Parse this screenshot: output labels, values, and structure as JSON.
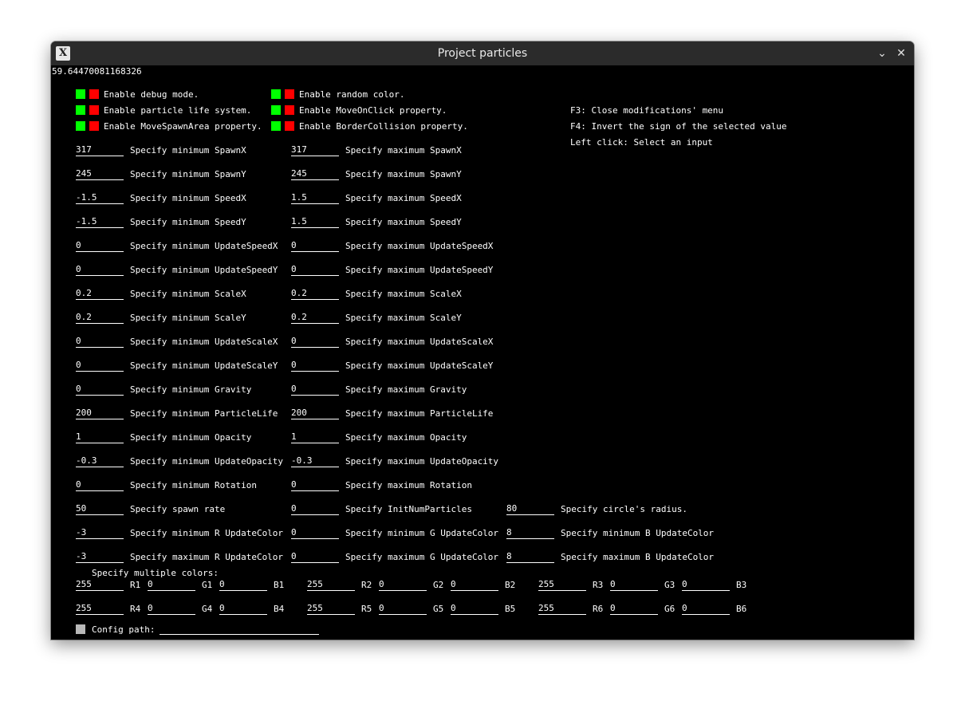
{
  "window": {
    "title": "Project particles",
    "icon": "x-window-icon",
    "controls": [
      "chevron-down-icon",
      "close-icon"
    ]
  },
  "fps": "59.64470081168326",
  "toggles": [
    {
      "label": "Enable debug mode."
    },
    {
      "label": "Enable particle life system."
    },
    {
      "label": "Enable MoveSpawnArea property."
    },
    {
      "label": "Enable random color."
    },
    {
      "label": "Enable MoveOnClick property."
    },
    {
      "label": "Enable BorderCollision property."
    }
  ],
  "help": [
    "F3: Close modifications' menu",
    "F4: Invert the sign of the selected value",
    "Left click: Select an input"
  ],
  "pairs": [
    {
      "min": "317",
      "min_label": "Specify minimum SpawnX",
      "max": "317",
      "max_label": "Specify maximum SpawnX"
    },
    {
      "min": "245",
      "min_label": "Specify minimum SpawnY",
      "max": "245",
      "max_label": "Specify maximum SpawnY"
    },
    {
      "min": "-1.5",
      "min_label": "Specify minimum SpeedX",
      "max": "1.5",
      "max_label": "Specify maximum SpeedX"
    },
    {
      "min": "-1.5",
      "min_label": "Specify minimum SpeedY",
      "max": "1.5",
      "max_label": "Specify maximum SpeedY"
    },
    {
      "min": "0",
      "min_label": "Specify minimum UpdateSpeedX",
      "max": "0",
      "max_label": "Specify maximum UpdateSpeedX"
    },
    {
      "min": "0",
      "min_label": "Specify minimum UpdateSpeedY",
      "max": "0",
      "max_label": "Specify maximum UpdateSpeedY"
    },
    {
      "min": "0.2",
      "min_label": "Specify minimum ScaleX",
      "max": "0.2",
      "max_label": "Specify maximum ScaleX"
    },
    {
      "min": "0.2",
      "min_label": "Specify minimum ScaleY",
      "max": "0.2",
      "max_label": "Specify maximum ScaleY"
    },
    {
      "min": "0",
      "min_label": "Specify minimum UpdateScaleX",
      "max": "0",
      "max_label": "Specify maximum UpdateScaleX"
    },
    {
      "min": "0",
      "min_label": "Specify minimum UpdateScaleY",
      "max": "0",
      "max_label": "Specify maximum UpdateScaleY"
    },
    {
      "min": "0",
      "min_label": "Specify minimum Gravity",
      "max": "0",
      "max_label": "Specify maximum Gravity"
    },
    {
      "min": "200",
      "min_label": "Specify minimum ParticleLife",
      "max": "200",
      "max_label": "Specify maximum ParticleLife"
    },
    {
      "min": "1",
      "min_label": "Specify minimum Opacity",
      "max": "1",
      "max_label": "Specify maximum Opacity"
    },
    {
      "min": "-0.3",
      "min_label": "Specify minimum UpdateOpacity",
      "max": "-0.3",
      "max_label": "Specify maximum UpdateOpacity"
    },
    {
      "min": "0",
      "min_label": "Specify minimum Rotation",
      "max": "0",
      "max_label": "Specify maximum Rotation"
    }
  ],
  "triples": [
    [
      {
        "value": "50",
        "label": "Specify spawn rate"
      },
      {
        "value": "0",
        "label": "Specify InitNumParticles"
      },
      {
        "value": "80",
        "label": "Specify circle's radius."
      }
    ],
    [
      {
        "value": "-3",
        "label": "Specify minimum R UpdateColor"
      },
      {
        "value": "0",
        "label": "Specify minimum G UpdateColor"
      },
      {
        "value": "8",
        "label": "Specify minimum B UpdateColor"
      }
    ],
    [
      {
        "value": "-3",
        "label": "Specify maximum R UpdateColor"
      },
      {
        "value": "0",
        "label": "Specify maximum G UpdateColor"
      },
      {
        "value": "8",
        "label": "Specify maximum B UpdateColor"
      }
    ]
  ],
  "multi_colors": {
    "label": "Specify multiple colors:",
    "rows": [
      [
        {
          "r": "255",
          "r_label": "R1",
          "g": "0",
          "g_label": "G1",
          "b": "0",
          "b_label": "B1"
        },
        {
          "r": "255",
          "r_label": "R2",
          "g": "0",
          "g_label": "G2",
          "b": "0",
          "b_label": "B2"
        },
        {
          "r": "255",
          "r_label": "R3",
          "g": "0",
          "g_label": "G3",
          "b": "0",
          "b_label": "B3"
        }
      ],
      [
        {
          "r": "255",
          "r_label": "R4",
          "g": "0",
          "g_label": "G4",
          "b": "0",
          "b_label": "B4"
        },
        {
          "r": "255",
          "r_label": "R5",
          "g": "0",
          "g_label": "G5",
          "b": "0",
          "b_label": "B5"
        },
        {
          "r": "255",
          "r_label": "R6",
          "g": "0",
          "g_label": "G6",
          "b": "0",
          "b_label": "B6"
        }
      ]
    ]
  },
  "config": {
    "label": "Config path:",
    "value": ""
  },
  "colors": {
    "on": "#00ff00",
    "off": "#ff0000",
    "background": "#000000",
    "text": "#ffffff"
  }
}
